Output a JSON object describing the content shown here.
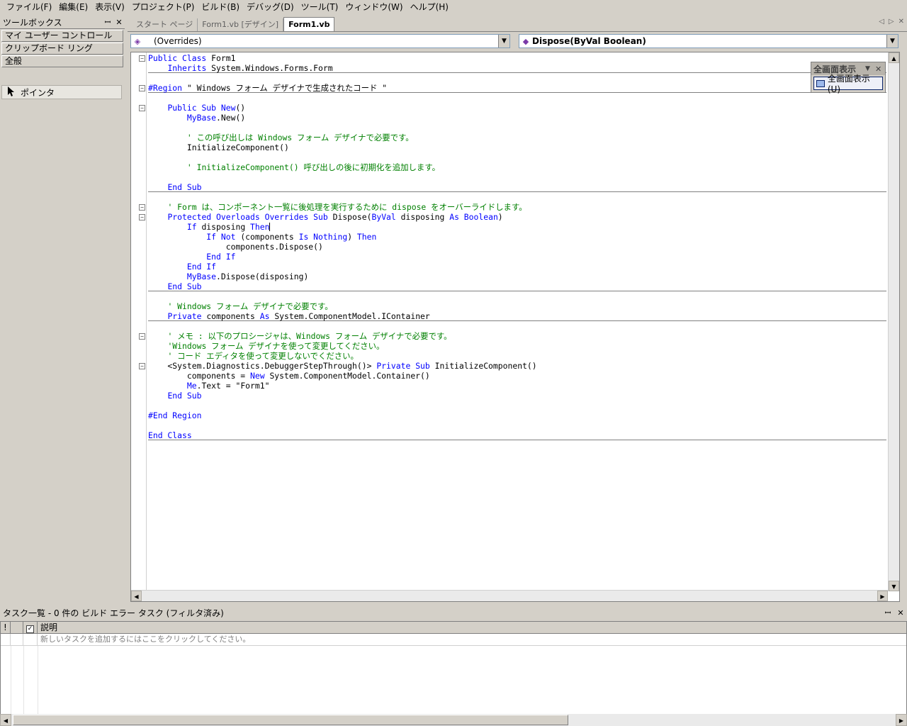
{
  "menu": [
    "ファイル(F)",
    "編集(E)",
    "表示(V)",
    "プロジェクト(P)",
    "ビルド(B)",
    "デバッグ(D)",
    "ツール(T)",
    "ウィンドウ(W)",
    "ヘルプ(H)"
  ],
  "toolbox": {
    "title": "ツールボックス",
    "pin": "ꟷ",
    "close": "✕",
    "sections": [
      "マイ ユーザー コントロール",
      "クリップボード リング",
      "全般"
    ],
    "item": "ポインタ"
  },
  "tabs": [
    "スタート ページ",
    "Form1.vb [デザイン]",
    "Form1.vb"
  ],
  "active_tab": "Form1.vb",
  "dropdowns": {
    "class": "(Overrides)",
    "method": "Dispose(ByVal Boolean)"
  },
  "fullscreen": {
    "title": "全画面表示",
    "button": "全画面表示(U)"
  },
  "tasklist": {
    "title": "タスク一覧 - 0 件の ビルド エラー タスク (フィルタ済み)",
    "header_bang": "!",
    "header_desc": "説明",
    "new_task_hint": "新しいタスクを追加するにはここをクリックしてください。"
  },
  "code": [
    {
      "t": [
        [
          "kw",
          "Public Class "
        ],
        [
          "",
          "Form1"
        ]
      ],
      "fold": "⊟"
    },
    {
      "t": [
        [
          "",
          "    "
        ],
        [
          "kw",
          "Inherits "
        ],
        [
          "",
          "System.Windows.Forms.Form"
        ]
      ],
      "sep": true
    },
    {
      "t": [
        [
          "",
          ""
        ]
      ]
    },
    {
      "t": [
        [
          "kw",
          "#Region "
        ],
        [
          "",
          "\" Windows フォーム デザイナで生成されたコード \""
        ]
      ],
      "fold": "⊟",
      "sep": true
    },
    {
      "t": [
        [
          "",
          ""
        ]
      ]
    },
    {
      "t": [
        [
          "",
          "    "
        ],
        [
          "kw",
          "Public Sub New"
        ],
        [
          "",
          "()"
        ]
      ],
      "fold": "⊟"
    },
    {
      "t": [
        [
          "",
          "        "
        ],
        [
          "kw",
          "MyBase"
        ],
        [
          "",
          ".New()"
        ]
      ]
    },
    {
      "t": [
        [
          "",
          ""
        ]
      ]
    },
    {
      "t": [
        [
          "",
          "        "
        ],
        [
          "cm",
          "' この呼び出しは Windows フォーム デザイナで必要です。"
        ]
      ]
    },
    {
      "t": [
        [
          "",
          "        InitializeComponent()"
        ]
      ]
    },
    {
      "t": [
        [
          "",
          ""
        ]
      ]
    },
    {
      "t": [
        [
          "",
          "        "
        ],
        [
          "cm",
          "' InitializeComponent() 呼び出しの後に初期化を追加します。"
        ]
      ]
    },
    {
      "t": [
        [
          "",
          ""
        ]
      ]
    },
    {
      "t": [
        [
          "",
          "    "
        ],
        [
          "kw",
          "End Sub"
        ]
      ],
      "sep": true
    },
    {
      "t": [
        [
          "",
          ""
        ]
      ]
    },
    {
      "t": [
        [
          "",
          "    "
        ],
        [
          "cm",
          "' Form は、コンポーネント一覧に後処理を実行するために dispose をオーバーライドします。"
        ]
      ],
      "fold": "⊟"
    },
    {
      "t": [
        [
          "",
          "    "
        ],
        [
          "kw",
          "Protected Overloads Overrides Sub "
        ],
        [
          "",
          "Dispose("
        ],
        [
          "kw",
          "ByVal "
        ],
        [
          "",
          "disposing "
        ],
        [
          "kw",
          "As Boolean"
        ],
        [
          "",
          ")"
        ]
      ],
      "fold": "⊟"
    },
    {
      "t": [
        [
          "",
          "        "
        ],
        [
          "kw",
          "If "
        ],
        [
          "",
          "disposing "
        ],
        [
          "kw",
          "Then"
        ]
      ],
      "caret": true
    },
    {
      "t": [
        [
          "",
          "            "
        ],
        [
          "kw",
          "If Not "
        ],
        [
          "",
          "(components "
        ],
        [
          "kw",
          "Is Nothing"
        ],
        [
          "",
          ") "
        ],
        [
          "kw",
          "Then"
        ]
      ]
    },
    {
      "t": [
        [
          "",
          "                components.Dispose()"
        ]
      ]
    },
    {
      "t": [
        [
          "",
          "            "
        ],
        [
          "kw",
          "End If"
        ]
      ]
    },
    {
      "t": [
        [
          "",
          "        "
        ],
        [
          "kw",
          "End If"
        ]
      ]
    },
    {
      "t": [
        [
          "",
          "        "
        ],
        [
          "kw",
          "MyBase"
        ],
        [
          "",
          ".Dispose(disposing)"
        ]
      ]
    },
    {
      "t": [
        [
          "",
          "    "
        ],
        [
          "kw",
          "End Sub"
        ]
      ],
      "sep": true
    },
    {
      "t": [
        [
          "",
          ""
        ]
      ]
    },
    {
      "t": [
        [
          "",
          "    "
        ],
        [
          "cm",
          "' Windows フォーム デザイナで必要です。"
        ]
      ]
    },
    {
      "t": [
        [
          "",
          "    "
        ],
        [
          "kw",
          "Private "
        ],
        [
          "",
          "components "
        ],
        [
          "kw",
          "As "
        ],
        [
          "",
          "System.ComponentModel.IContainer"
        ]
      ],
      "sep": true
    },
    {
      "t": [
        [
          "",
          ""
        ]
      ]
    },
    {
      "t": [
        [
          "",
          "    "
        ],
        [
          "cm",
          "' メモ : 以下のプロシージャは、Windows フォーム デザイナで必要です。"
        ]
      ],
      "fold": "⊟"
    },
    {
      "t": [
        [
          "",
          "    "
        ],
        [
          "cm",
          "'Windows フォーム デザイナを使って変更してください。"
        ]
      ]
    },
    {
      "t": [
        [
          "",
          "    "
        ],
        [
          "cm",
          "' コード エディタを使って変更しないでください。"
        ]
      ]
    },
    {
      "t": [
        [
          "",
          "    <System.Diagnostics.DebuggerStepThrough()> "
        ],
        [
          "kw",
          "Private Sub "
        ],
        [
          "",
          "InitializeComponent()"
        ]
      ],
      "fold": "⊟"
    },
    {
      "t": [
        [
          "",
          "        components = "
        ],
        [
          "kw",
          "New "
        ],
        [
          "",
          "System.ComponentModel.Container()"
        ]
      ]
    },
    {
      "t": [
        [
          "",
          "        "
        ],
        [
          "kw",
          "Me"
        ],
        [
          "",
          ".Text = \"Form1\""
        ]
      ]
    },
    {
      "t": [
        [
          "",
          "    "
        ],
        [
          "kw",
          "End Sub"
        ]
      ]
    },
    {
      "t": [
        [
          "",
          ""
        ]
      ]
    },
    {
      "t": [
        [
          "kw",
          "#End Region"
        ]
      ]
    },
    {
      "t": [
        [
          "",
          ""
        ]
      ]
    },
    {
      "t": [
        [
          "kw",
          "End Class"
        ]
      ],
      "sep": true
    }
  ]
}
